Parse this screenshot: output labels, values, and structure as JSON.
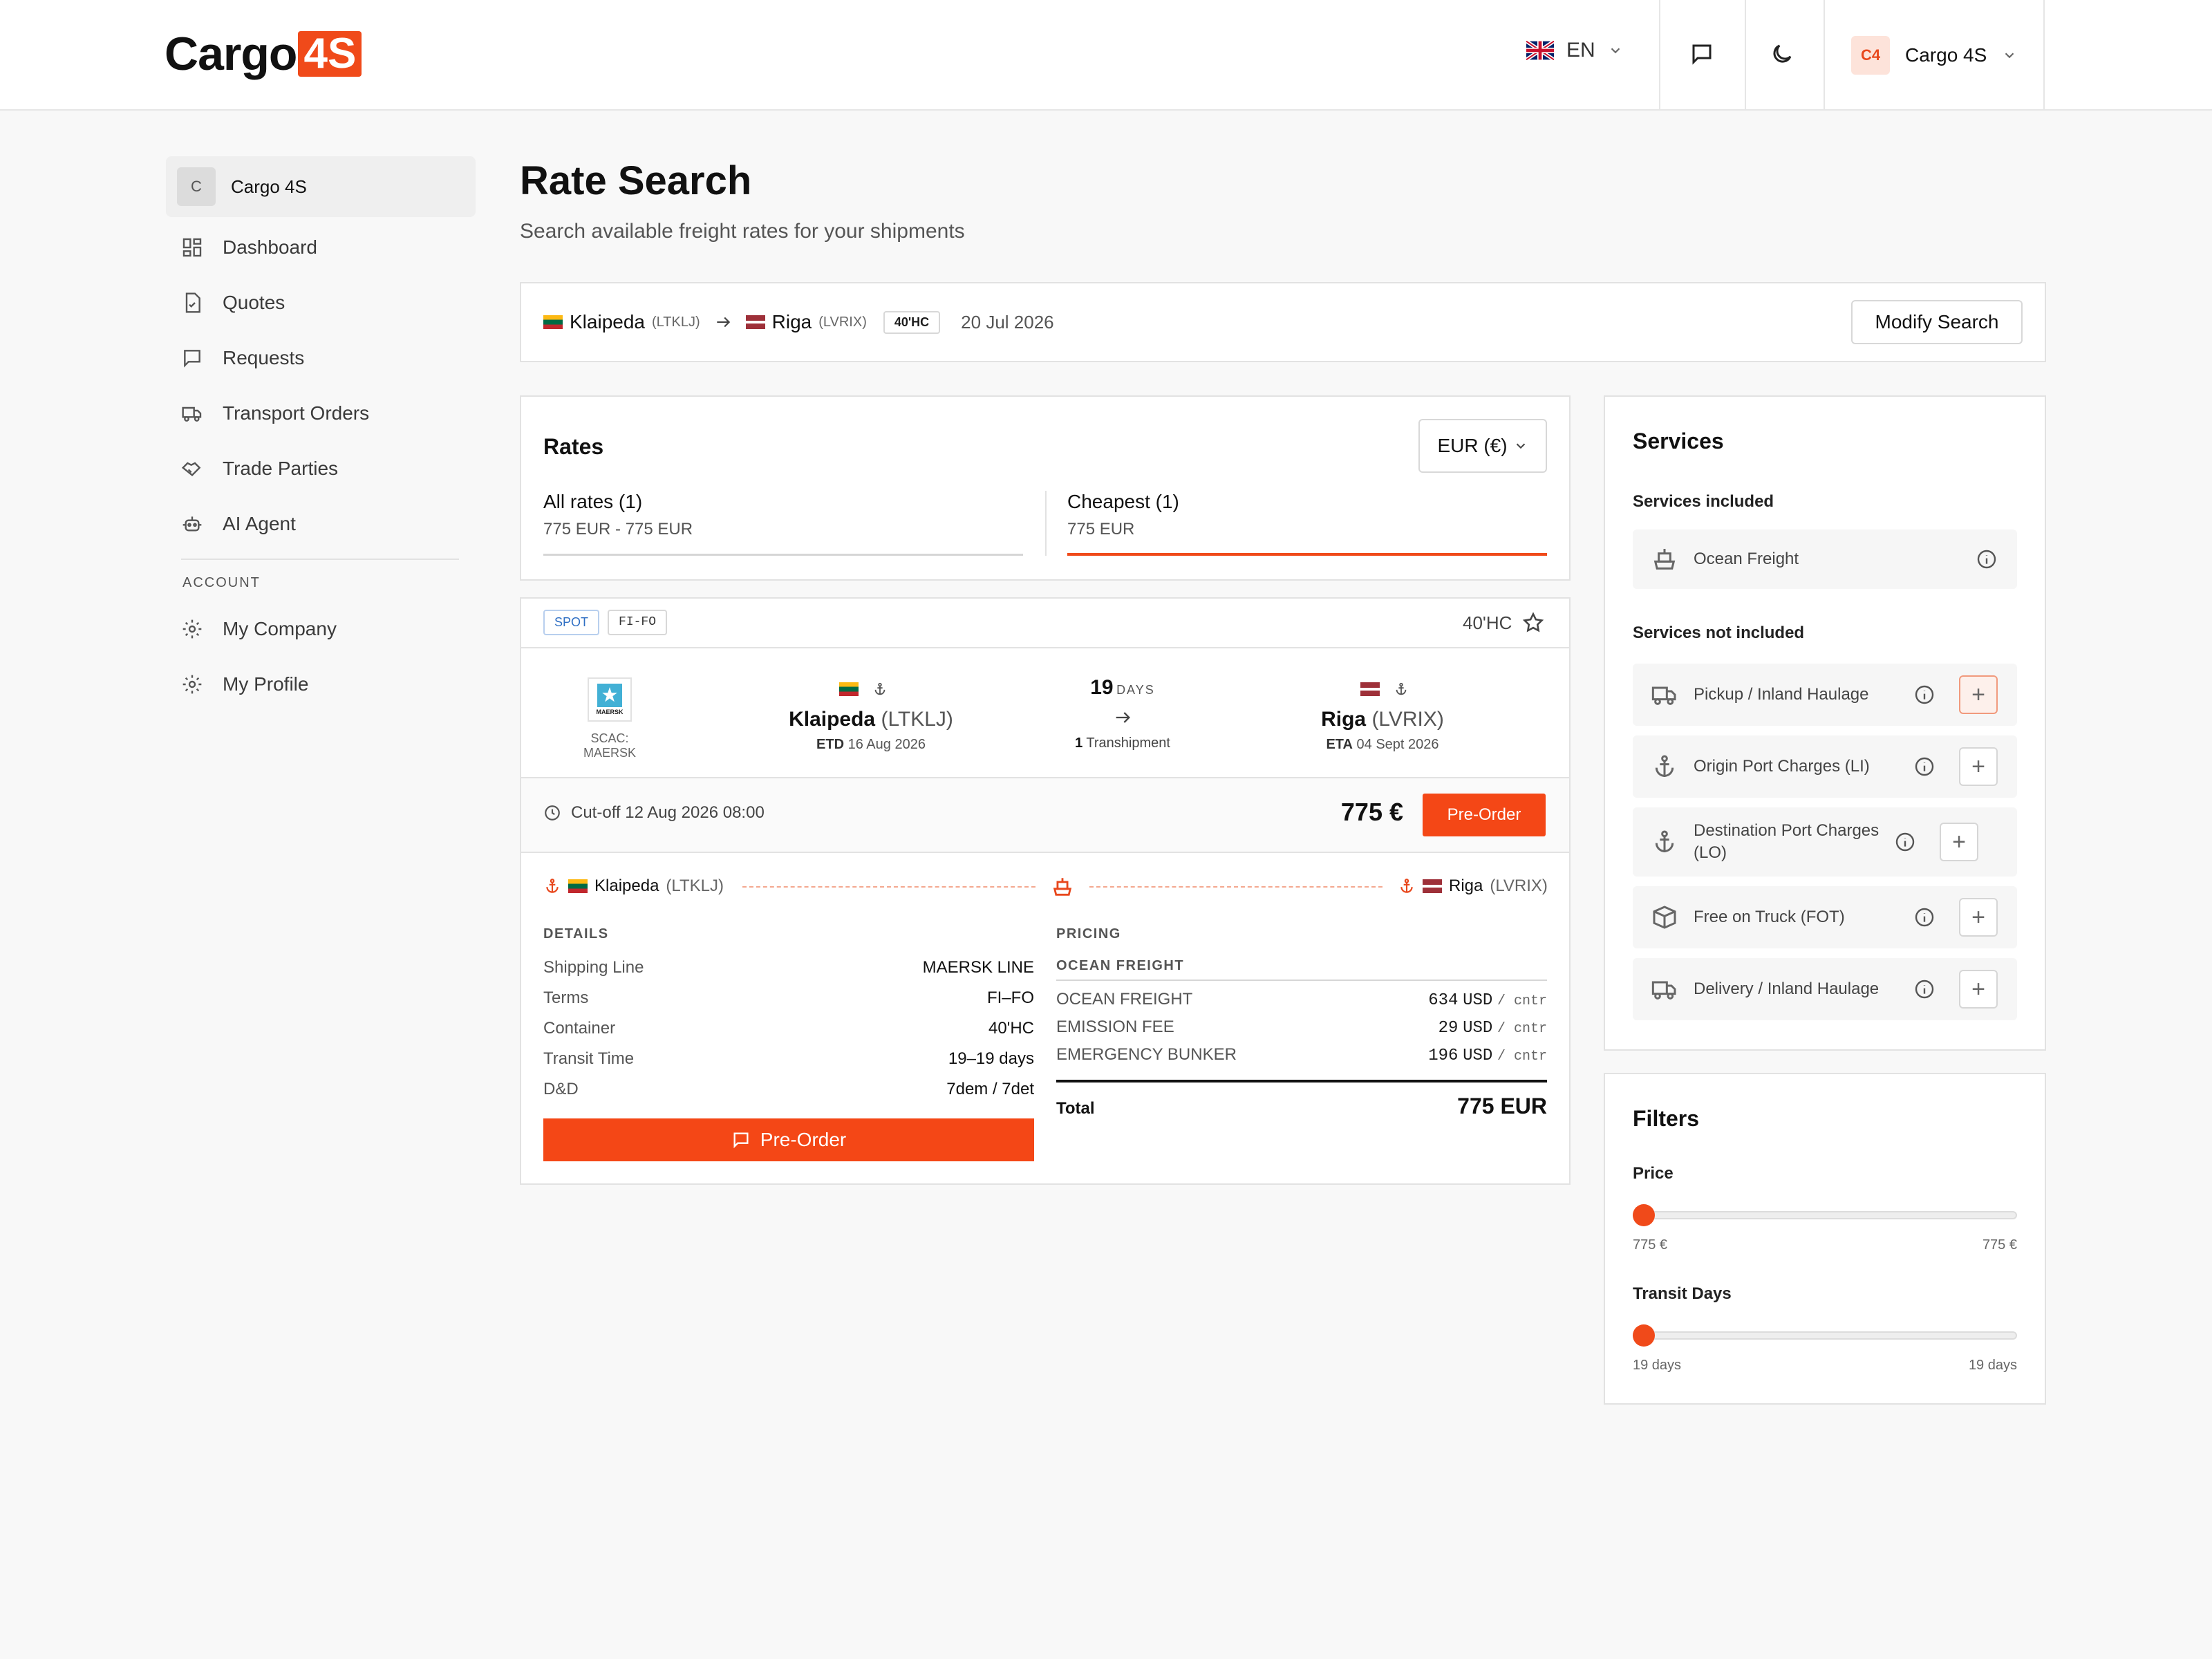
{
  "header": {
    "logo_word": "Cargo",
    "logo_badge": "4S",
    "language": "EN",
    "account_initials": "C4",
    "account_name": "Cargo 4S"
  },
  "sidebar": {
    "org_initial": "C",
    "org_name": "Cargo 4S",
    "items": [
      {
        "label": "Dashboard",
        "icon": "dashboard-grid-icon"
      },
      {
        "label": "Quotes",
        "icon": "document-icon"
      },
      {
        "label": "Requests",
        "icon": "chat-icon"
      },
      {
        "label": "Transport Orders",
        "icon": "truck-icon"
      },
      {
        "label": "Trade Parties",
        "icon": "handshake-icon"
      },
      {
        "label": "AI Agent",
        "icon": "robot-icon"
      }
    ],
    "account_section": "ACCOUNT",
    "account_items": [
      {
        "label": "My Company",
        "icon": "gear-icon"
      },
      {
        "label": "My Profile",
        "icon": "gear-icon"
      }
    ]
  },
  "page": {
    "title": "Rate Search",
    "subtitle": "Search available freight rates for your shipments"
  },
  "search": {
    "origin": "Klaipeda",
    "origin_code": "(LTKLJ)",
    "destination": "Riga",
    "destination_code": "(LVRIX)",
    "container": "40'HC",
    "date": "20 Jul 2026",
    "modify_label": "Modify Search"
  },
  "rates": {
    "title": "Rates",
    "currency": "EUR (€)",
    "tab_all_label": "All rates (1)",
    "tab_all_range": "775 EUR - 775 EUR",
    "tab_cheapest_label": "Cheapest (1)",
    "tab_cheapest_range": "775 EUR"
  },
  "rate_card": {
    "tag_spot": "SPOT",
    "tag_terms": "FI-FO",
    "container": "40'HC",
    "carrier_logo_text": "MAERSK",
    "scac": "SCAC: MAERSK",
    "origin_city": "Klaipeda",
    "origin_code": "(LTKLJ)",
    "etd_label": "ETD",
    "etd_date": "16 Aug 2026",
    "transit_days": "19",
    "days_label": "DAYS",
    "transhipment_count": "1",
    "transhipment_label": "Transhipment",
    "dest_city": "Riga",
    "dest_code": "(LVRIX)",
    "eta_label": "ETA",
    "eta_date": "04 Sept 2026",
    "cutoff": "Cut-off 12 Aug 2026 08:00",
    "price": "775 €",
    "preorder_label": "Pre-Order",
    "route_origin": "Klaipeda",
    "route_origin_code": "(LTKLJ)",
    "route_dest": "Riga",
    "route_dest_code": "(LVRIX)",
    "details_title": "DETAILS",
    "details": [
      {
        "k": "Shipping Line",
        "v": "MAERSK LINE"
      },
      {
        "k": "Terms",
        "v": "FI–FO"
      },
      {
        "k": "Container",
        "v": "40'HC"
      },
      {
        "k": "Transit Time",
        "v": "19–19 days"
      },
      {
        "k": "D&D",
        "v": "7dem / 7det"
      }
    ],
    "pricing_title": "PRICING",
    "pricing_group": "OCEAN FREIGHT",
    "pricing": [
      {
        "k": "OCEAN FREIGHT",
        "amount": "634",
        "cur": "USD",
        "unit": "/ cntr"
      },
      {
        "k": "EMISSION FEE",
        "amount": "29",
        "cur": "USD",
        "unit": "/ cntr"
      },
      {
        "k": "EMERGENCY BUNKER",
        "amount": "196",
        "cur": "USD",
        "unit": "/ cntr"
      }
    ],
    "total_label": "Total",
    "total_value": "775 EUR"
  },
  "services": {
    "title": "Services",
    "included_title": "Services included",
    "included": [
      {
        "label": "Ocean Freight",
        "icon": "ship-icon"
      }
    ],
    "not_included_title": "Services not included",
    "not_included": [
      {
        "label": "Pickup / Inland Haulage",
        "icon": "truck-icon"
      },
      {
        "label": "Origin Port Charges (LI)",
        "icon": "anchor-icon"
      },
      {
        "label": "Destination Port Charges (LO)",
        "icon": "anchor-icon"
      },
      {
        "label": "Free on Truck (FOT)",
        "icon": "box-icon"
      },
      {
        "label": "Delivery / Inland Haulage",
        "icon": "truck-icon"
      }
    ]
  },
  "filters": {
    "title": "Filters",
    "price_label": "Price",
    "price_min": "775 €",
    "price_max": "775 €",
    "price_value_fraction": 0,
    "transit_label": "Transit Days",
    "transit_min": "19 days",
    "transit_max": "19 days",
    "transit_value_fraction": 0
  },
  "colors": {
    "accent": "#f44716",
    "border": "#e2e2e2",
    "background": "#f8f8f8"
  }
}
